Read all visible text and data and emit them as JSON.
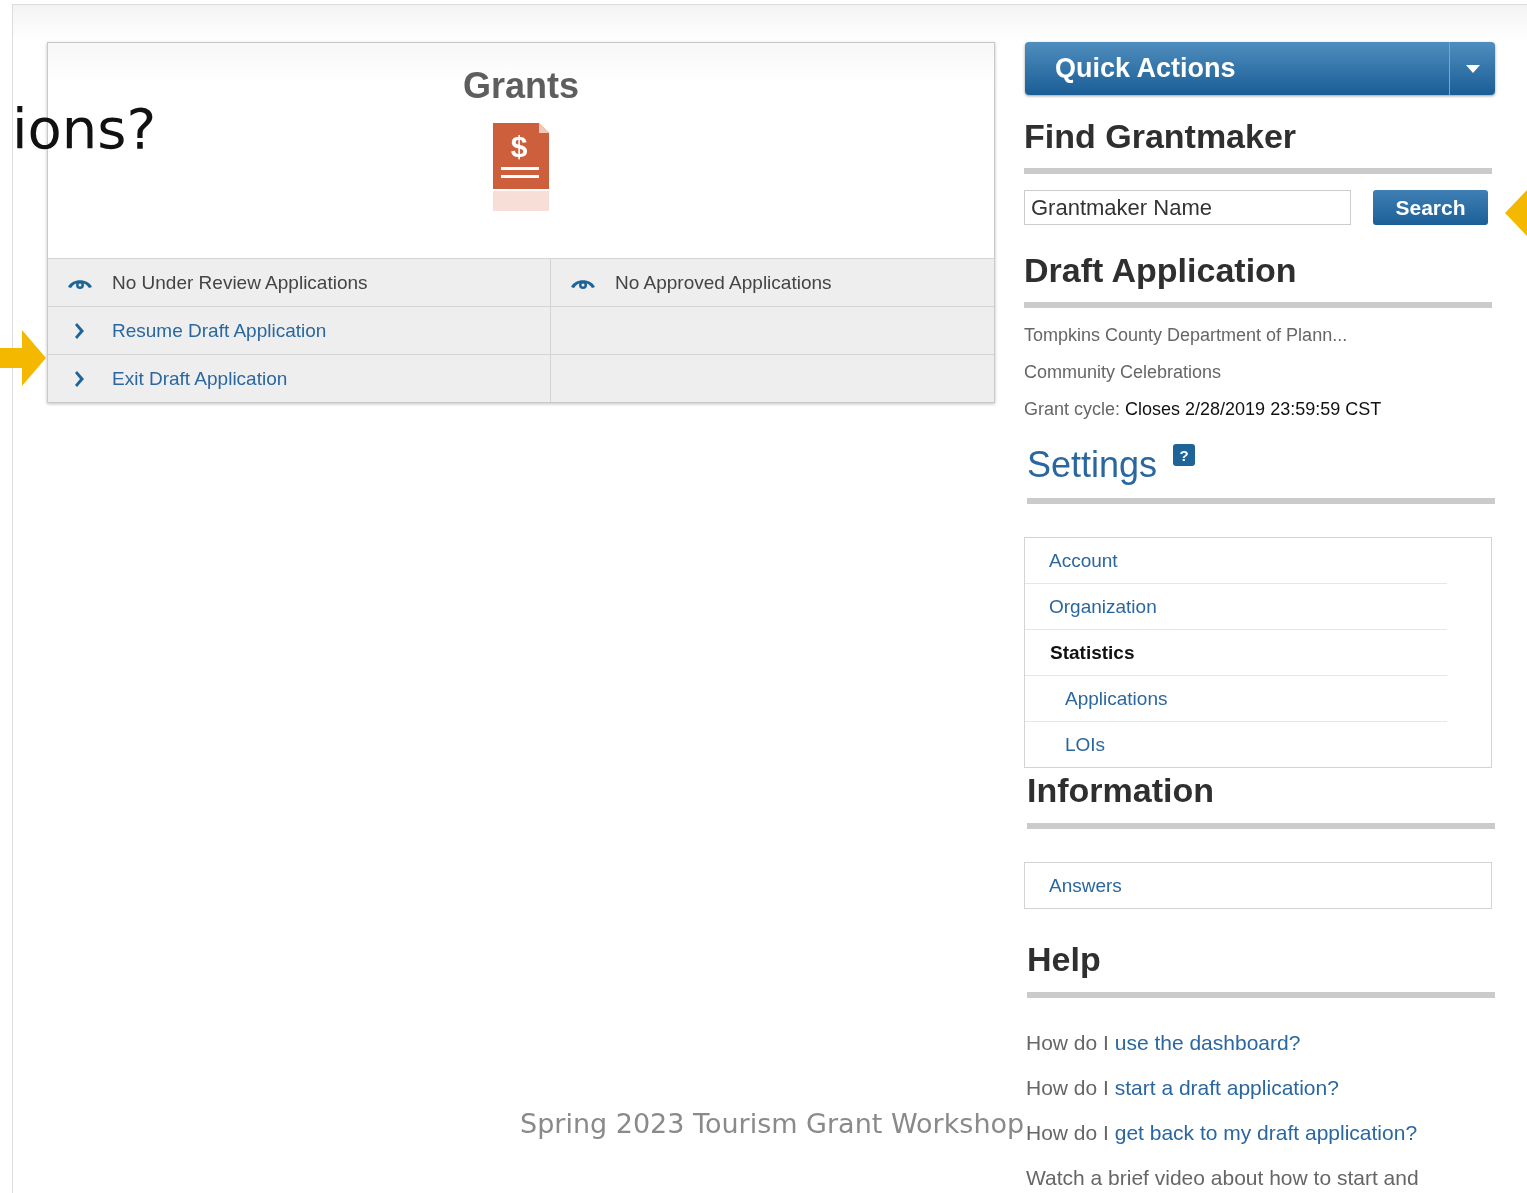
{
  "slide": {
    "title_fragments": [
      "ions?"
    ],
    "footer": "Spring 2023 Tourism Grant Workshop"
  },
  "grants_card": {
    "title": "Grants",
    "icon_glyph": "$",
    "rows": [
      {
        "left": {
          "kind": "status",
          "label": "No Under Review Applications"
        },
        "right": {
          "kind": "status",
          "label": "No Approved Applications"
        }
      },
      {
        "left": {
          "kind": "link",
          "label": "Resume Draft Application"
        }
      },
      {
        "left": {
          "kind": "link",
          "label": "Exit Draft Application"
        }
      }
    ]
  },
  "quick_actions": {
    "label": "Quick Actions"
  },
  "find_grantmaker": {
    "heading": "Find Grantmaker",
    "placeholder": "Grantmaker Name",
    "button": "Search"
  },
  "draft_application": {
    "heading": "Draft Application",
    "grantmaker": "Tompkins County Department of Plann...",
    "program": "Community Celebrations",
    "cycle_label": "Grant cycle:",
    "cycle_value": "Closes 2/28/2019 23:59:59 CST"
  },
  "settings": {
    "heading": "Settings",
    "help_glyph": "?",
    "items": [
      {
        "label": "Account"
      },
      {
        "label": "Organization"
      },
      {
        "label": "Statistics",
        "children": [
          {
            "label": "Applications"
          },
          {
            "label": "LOIs"
          }
        ]
      }
    ]
  },
  "information": {
    "heading": "Information",
    "items": [
      {
        "label": "Answers"
      }
    ]
  },
  "help": {
    "heading": "Help",
    "items": [
      {
        "kind": "link",
        "prefix": "How do I",
        "link": "use the dashboard?"
      },
      {
        "kind": "link",
        "prefix": "How do I",
        "link": "start a draft application?"
      },
      {
        "kind": "link",
        "prefix": "How do I",
        "link": "get back to my draft application?"
      },
      {
        "kind": "text",
        "text": "Watch a brief video about how to start and"
      }
    ]
  }
}
